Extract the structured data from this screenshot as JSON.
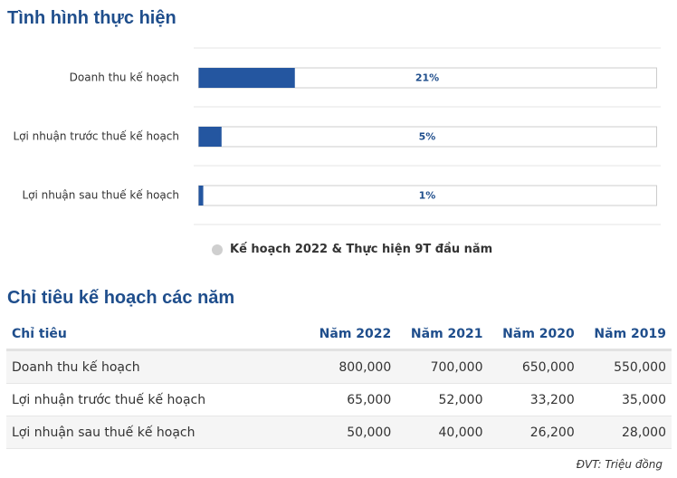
{
  "sections": {
    "progress_title": "Tình hình thực hiện",
    "plan_title": "Chỉ tiêu kế hoạch các năm"
  },
  "chart_data": {
    "type": "bar",
    "orientation": "horizontal",
    "categories": [
      "Doanh thu kế hoạch",
      "Lợi nhuận trước thuế kế hoạch",
      "Lợi nhuận sau thuế kế hoạch"
    ],
    "values": [
      21,
      5,
      1
    ],
    "value_labels": [
      "21%",
      "5%",
      "1%"
    ],
    "xlim": [
      0,
      100
    ],
    "legend": "Kế hoạch 2022 & Thực hiện 9T đầu năm",
    "legend_position": "bottom",
    "bar_color": "#2456a0",
    "track_color": "#ffffff",
    "grid": false
  },
  "table": {
    "headers": [
      "Chỉ tiêu",
      "Năm 2022",
      "Năm 2021",
      "Năm 2020",
      "Năm 2019"
    ],
    "rows": [
      [
        "Doanh thu kế hoạch",
        "800,000",
        "700,000",
        "650,000",
        "550,000"
      ],
      [
        "Lợi nhuận trước thuế kế hoạch",
        "65,000",
        "52,000",
        "33,200",
        "35,000"
      ],
      [
        "Lợi nhuận sau thuế kế hoạch",
        "50,000",
        "40,000",
        "26,200",
        "28,000"
      ]
    ]
  },
  "unit_note": "ĐVT: Triệu đồng",
  "colors": {
    "accent": "#1f4e8c",
    "legend_dot": "#cfcfcf"
  }
}
